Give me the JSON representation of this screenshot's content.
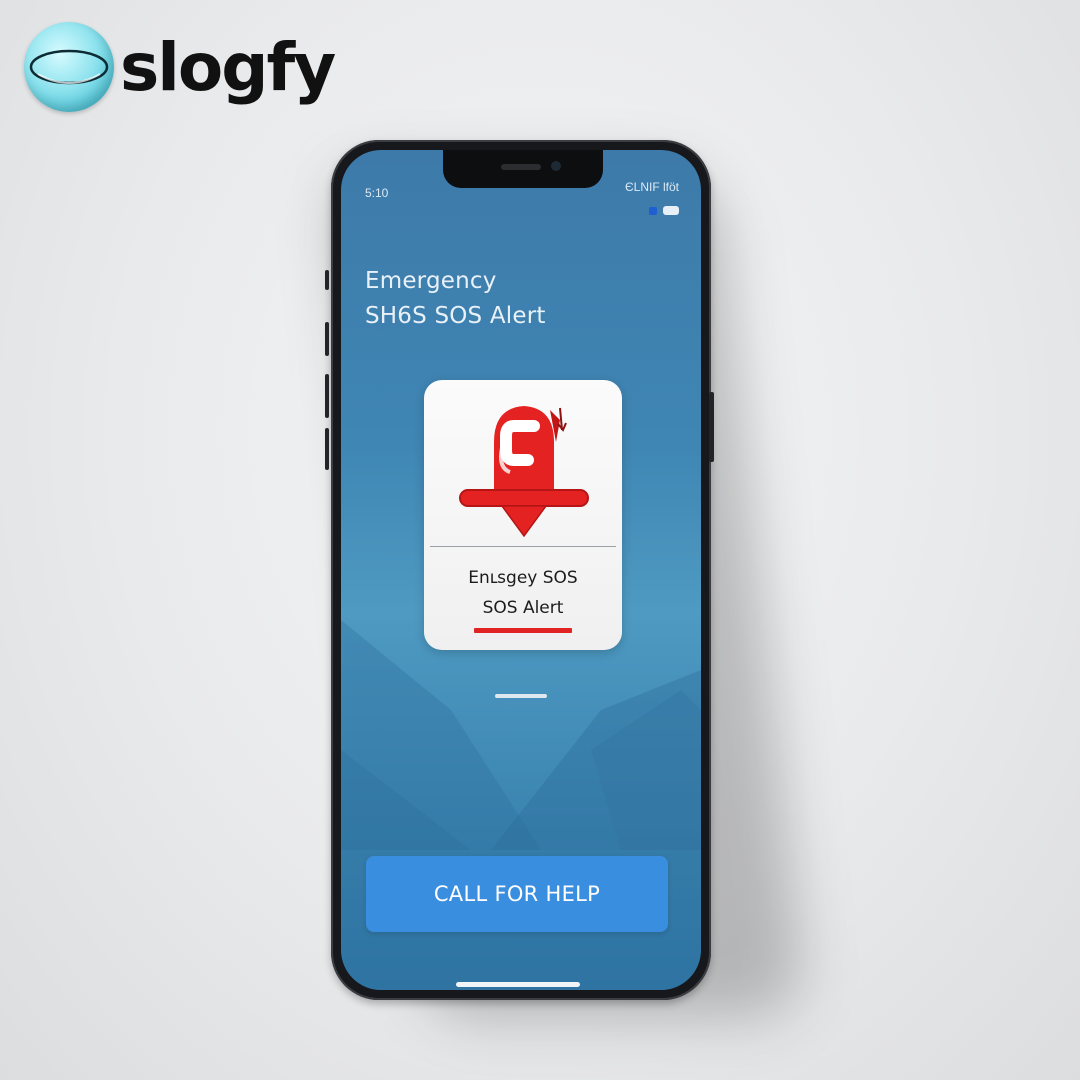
{
  "brand": {
    "name": "slogfy",
    "badge_text": "SLOGFY"
  },
  "status_bar": {
    "time": "5:10",
    "carrier": "ЄLNIF lföt"
  },
  "screen": {
    "title_line_1": "Emergency",
    "title_line_2": "SH6S SOS Alert",
    "card": {
      "icon": "red-alert-bell-icon",
      "line_1": "Enւsgey SOS",
      "line_2": "SOS Alert"
    },
    "cta_label": "CALL FOR HELP"
  },
  "colors": {
    "screen_blue": "#3f86b4",
    "cta_blue": "#3a8ee0",
    "alert_red": "#e52222"
  }
}
